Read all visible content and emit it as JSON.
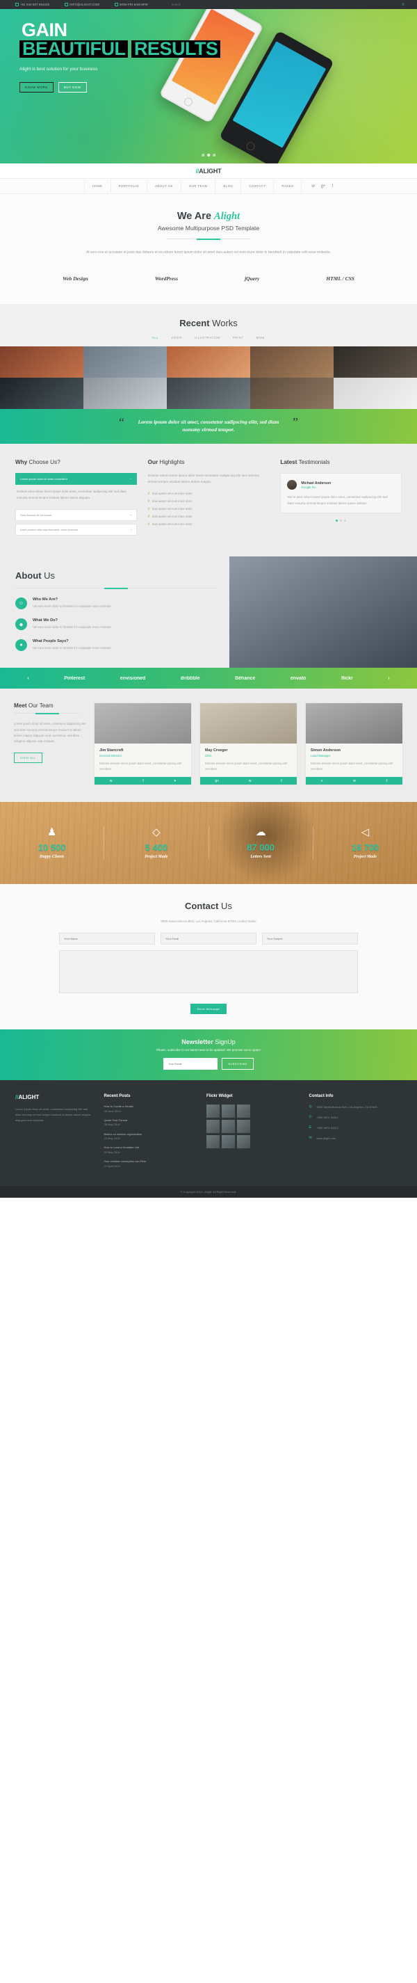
{
  "topbar": {
    "phone": "+91 544 567 894326",
    "email": "INFO@ALIGHT.COM",
    "hours": "MON-FRI 8AM-6PM",
    "search_placeholder": "Search",
    "search_value": "",
    "search_icon": "search-icon"
  },
  "hero": {
    "line1": "GAIN",
    "line2": "BEAUTIFUL",
    "line3": "RESULTS",
    "subtitle": "Alight is best solution for your business",
    "btn_primary": "KNOW MORE",
    "btn_secondary": "BUY NOW",
    "dots": 3,
    "active_dot": 1
  },
  "brand": {
    "slashes": "//",
    "name": "ALIGHT"
  },
  "nav": {
    "items": [
      "HOME",
      "PORTFOLIO",
      "ABOUT US",
      "OUR TEAM",
      "BLOG",
      "CONTACT",
      "PAGES"
    ],
    "socials": [
      "twitter-icon",
      "google-plus-icon",
      "facebook-icon"
    ]
  },
  "intro": {
    "heading_strong": "We Are ",
    "heading_em": "Alight",
    "subtitle": "Awesome Multipurpose PSD Template",
    "paragraph": "At vero eos et accusam et justo duo dolores et ea rebum lorem ipsum dolor sit amet duis autem vel eum iriure dolor in hendrerit in vulputate velit esse molestie.",
    "skills": [
      "Web Design",
      "WordPress",
      "jQuery",
      "HTML / CSS"
    ]
  },
  "works": {
    "title_strong": "Recent",
    "title_light": " Works",
    "filters": [
      "ALL",
      "VIDEO",
      "ILLUSTRATION",
      "PRINT",
      "MISE"
    ],
    "active_filter": "ALL"
  },
  "quote": {
    "open": "“",
    "close": "”",
    "text": "Lorem ipsum dolor sit amet, consetetur sadipscing elitr, sed diam nonumy eirmod tempor."
  },
  "why": {
    "title_strong": "Why",
    "title_light": " Choose Us?",
    "items": [
      {
        "label": "Lorem ipsum dolor sit amet consetetur",
        "open": true,
        "body": "Dolores etea rebum lorem ipsum dolor amet, consetetur sadipscing elitr sed diam nonumy eirmod tempor invidunt labore dolore aliquam."
      },
      {
        "label": "Duis dolores sit ea rebum",
        "open": false,
        "body": ""
      },
      {
        "label": "Amet purator clita reprehenderit, enim eiusmod",
        "open": false,
        "body": ""
      }
    ]
  },
  "highlights": {
    "title_strong": "Our",
    "title_light": " Highlights",
    "paragraph": "Dolores rebum lorem ipsum dolor amet consetetur sadipscing elitr iam nonumy eirmod tempor invidunt labore dolore magna.",
    "bullets": [
      "duis autem vel eum iriure dolor",
      "duis autem vel eum iriure dolor",
      "duis autem vel eum iriure dolor",
      "duis autem vel eum iriure dolor",
      "duis autem vel eum iriure dolor"
    ]
  },
  "testimonials": {
    "title_strong": "Latest",
    "title_light": " Testimonials",
    "author": "Michael Anderson",
    "company": "Google Inc.",
    "body": "Nisi te atea rebum lorem ipsum dolor amet, consetetur sadipscing elitr sed diam nonumy eirmod tempor invidunt labore ipsum dolores.",
    "dots": 3,
    "active_dot": 0
  },
  "about": {
    "title_strong": "About",
    "title_light": " Us",
    "features": [
      {
        "icon": "user-icon",
        "glyph": "☺",
        "title": "Who We Are?",
        "desc": "Vel eum iriure dolor in hendrerit in vulputate esse molestie"
      },
      {
        "icon": "diamond-icon",
        "glyph": "◆",
        "title": "What We Do?",
        "desc": "Vel eum iriure dolor in hendrerit in vulputate esse molestie"
      },
      {
        "icon": "chat-icon",
        "glyph": "●",
        "title": "What People Says?",
        "desc": "Vel eum iriure dolor in hendrerit in vulputate esse molestie"
      }
    ]
  },
  "clients": {
    "prev": "‹",
    "next": "›",
    "logos": [
      "Pinterest",
      "envisioned",
      "dribbble",
      "Béhance",
      "envato",
      "flickr"
    ]
  },
  "team": {
    "title_strong": "Meet",
    "title_light": " Our Team",
    "paragraph": "Lorem ipsum dolor sit amet, consetetur sadipscing elitr sed diam nonumy eirmod tempor invidunt ut labore dolore magna aliquyam erat consetetur, sed diam voluptua aliquam erat volutpat.",
    "view_all": "VIEW ALL",
    "members": [
      {
        "name": "Jim Stancroft",
        "role": "General Director",
        "desc": "Dolores eteaum lorem ipsum dolor amet, consetetur ipscing elitr sed diam.",
        "socials": [
          "twitter-icon",
          "facebook-icon",
          "chevron-down-icon"
        ]
      },
      {
        "name": "May Croeger",
        "role": "CEO",
        "desc": "Dolores eteaum lorem ipsum dolor amet, consetetur ipscing elitr sed diam.",
        "socials": [
          "google-plus-icon",
          "twitter-icon",
          "facebook-icon"
        ]
      },
      {
        "name": "Simon Anderson",
        "role": "Lead Manager",
        "desc": "Dolores eteaum lorem ipsum dolor amet, consetetur ipscing elitr sed diam.",
        "socials": [
          "vimeo-icon",
          "twitter-icon",
          "facebook-icon"
        ]
      }
    ]
  },
  "stats": [
    {
      "icon": "user-icon",
      "glyph": "♟",
      "number": "10 500",
      "label": "Happy Clients"
    },
    {
      "icon": "diamond-icon",
      "glyph": "◇",
      "number": "5 400",
      "label": "Project Made"
    },
    {
      "icon": "cloud-icon",
      "glyph": "☁",
      "number": "87 000",
      "label": "Letters Sent"
    },
    {
      "icon": "megaphone-icon",
      "glyph": "◁",
      "number": "16 700",
      "label": "Project Made"
    }
  ],
  "contact": {
    "title_strong": "Contact",
    "title_light": " Us",
    "address": "8605 Santa Monica Blvd, Los Angeles, California 87845, United States",
    "name_placeholder": "Your Name",
    "email_placeholder": "Your Email",
    "subject_placeholder": "Your Subject",
    "message_placeholder": "",
    "submit": "Send Message"
  },
  "newsletter": {
    "title_strong": "Newsletter",
    "title_light": " SignUp",
    "subtitle": "Please, subscribe to our latest news to be updated. We promise not to spam!",
    "email_placeholder": "Your Email",
    "button": "SUBSCRIBE"
  },
  "footer": {
    "about_text": "Lorem ipsum dolor sit amet, consetetur sadipscing elitr sed diam nonumy eirmod tempor invidunt ut labore dolore magna aliquyam erat voluptua.",
    "recent_posts_title": "Recent Posts",
    "recent_posts": [
      {
        "title": "How to Create a Header",
        "date": "05 June 2014"
      },
      {
        "title": "Quote Post Format",
        "date": "28 May 2014"
      },
      {
        "title": "Basics on mission organization",
        "date": "12 May 2014"
      },
      {
        "title": "How to Load a Headfrier Life",
        "date": "04 May 2014"
      },
      {
        "title": "Your creative conception can Rent",
        "date": "27 April 2014"
      }
    ],
    "flickr_title": "Flickr Widget",
    "contact_title": "Contact Info",
    "contact_items": [
      {
        "icon": "map-pin-icon",
        "glyph": "◎",
        "text": "8605 Santa Monica Blvd, Los Angeles, CA 87845"
      },
      {
        "icon": "phone-icon",
        "glyph": "✆",
        "text": "+555 9876 54321"
      },
      {
        "icon": "printer-icon",
        "glyph": "⌸",
        "text": "+555 9876 54322"
      },
      {
        "icon": "envelope-icon",
        "glyph": "✉",
        "text": "www.alight.com"
      }
    ],
    "copyright": "© Copyright 2014 - Alight. All Right Reserved."
  },
  "colors": {
    "accent": "#2ec4a0",
    "green": "#8cc63f",
    "dark": "#2f3437"
  }
}
